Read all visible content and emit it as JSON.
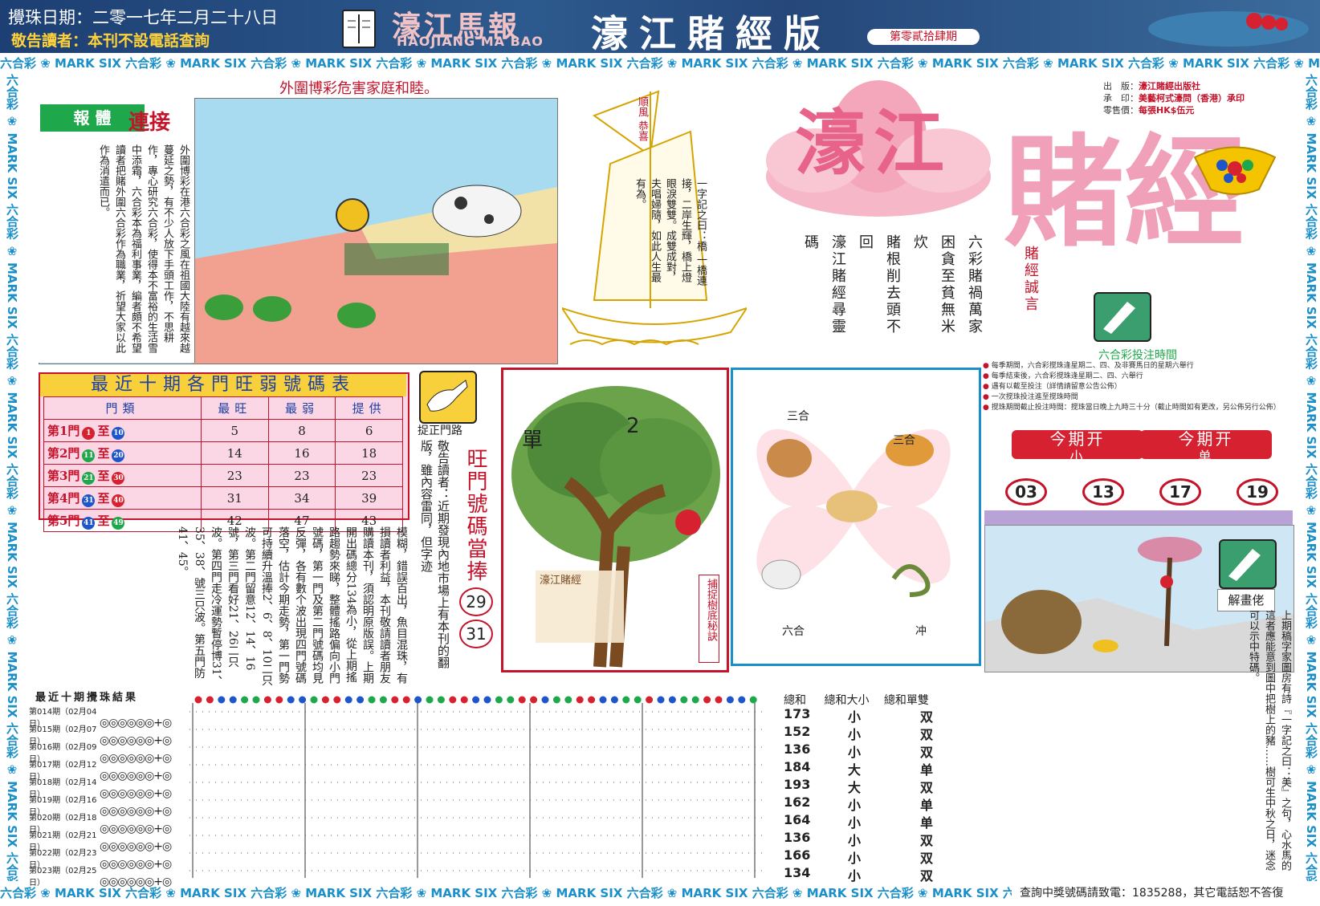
{
  "header": {
    "date": "攪珠日期：二零一七年二月二十八日",
    "warning": "敬告讀者：本刊不設電話查詢",
    "logo_cn": "濠江馬報",
    "logo_en": "HAOJIANG MA BAO",
    "title": "濠江賭經版",
    "issue": "第零貳拾肆期"
  },
  "strip_text": "六合彩 ❀ MARK SIX 六合彩 ❀ MARK SIX 六合彩 ❀ MARK SIX 六合彩 ❀ MARK SIX 六合彩 ❀ MARK SIX 六合彩 ❀ MARK SIX 六合彩 ❀ MARK SIX 六合彩 ❀ MARK SIX 六合彩 ❀ MARK SIX 六合彩 ❀ MARK SIX 六合彩 ❀ MARK SIX",
  "cartoon": {
    "caption": "外圍博彩危害家庭和睦。",
    "box_title": "報 體",
    "box_title_red": "連接",
    "box_text": "外圍博彩在港六合彩之風在祖國大陸有越來越蔓延之勢，有不少人放下手頭工作，不思耕作，專心研究六合彩，使得本不富裕的生活雪中添霜，六合彩本為福利事業，編者頗不希望讀者把賭外圍六合彩作為職業，祈望大家以此作為消遣而已。"
  },
  "boat": {
    "sail": "順風 恭喜",
    "text": "一字記之曰：橋 一橋連接，二岸生輝，橋上燈眼淚雙雙。成雙成對，夫唱婦隨，如此人生最有為。"
  },
  "brand": {
    "title_1": "濠江",
    "title_2": "賭經",
    "cols": [
      "六彩賭禍萬家",
      "困貪至貧無米炊",
      "賭根削去頭不回",
      "濠江賭經尋靈碼"
    ],
    "motto": "賭經誠言",
    "pub_lines": [
      {
        "k": "出　版：",
        "v": "濠江賭經出版社"
      },
      {
        "k": "承　印：",
        "v": "美藝柯式濠問（香港）承印"
      },
      {
        "k": "零售價：",
        "v": "每張HK$伍元"
      }
    ],
    "time_caption": "六合彩投注時間",
    "time_notes": [
      "每季期間，六合彩搅珠逢星期二、四、及非賽馬日的星期六舉行",
      "每季結束後，六合彩搅珠逢星期二、四、六舉行",
      "遇有以截至投注（詳情請留意公告公佈）",
      "一次搅珠投注進至搅珠時間",
      "搅珠期間截止投注時間：搅珠當日晚上九時三十分（截止時間如有更改，另公佈另行公佈）"
    ]
  },
  "table": {
    "title": "最近十期各門旺弱號碼表",
    "headers": [
      "門類",
      "最旺",
      "最弱",
      "提供"
    ],
    "rows": [
      {
        "door": "第1門",
        "from": "1",
        "to": "10",
        "max": "5",
        "min": "8",
        "give": "6",
        "c1": "b-r",
        "c2": "b-b"
      },
      {
        "door": "第2門",
        "from": "11",
        "to": "20",
        "max": "14",
        "min": "16",
        "give": "18",
        "c1": "b-g",
        "c2": "b-b"
      },
      {
        "door": "第3門",
        "from": "21",
        "to": "30",
        "max": "23",
        "min": "23",
        "give": "23",
        "c1": "b-g",
        "c2": "b-r"
      },
      {
        "door": "第4門",
        "from": "31",
        "to": "40",
        "max": "31",
        "min": "34",
        "give": "39",
        "c1": "b-b",
        "c2": "b-r"
      },
      {
        "door": "第5門",
        "from": "41",
        "to": "49",
        "max": "42",
        "min": "47",
        "give": "43",
        "c1": "b-b",
        "c2": "b-g"
      }
    ]
  },
  "tips": {
    "label": "捉正門路",
    "notice": "敬告讀者：近期發現內地市場上有本刊的翻版，雖內容雷同，但字迹",
    "wang_title": "旺門號碼當捧",
    "wang_nums": [
      "29",
      "31"
    ],
    "body": "模糊，錯誤百出，魚目混珠，有損讀者利益，本刊敬請讀者朋友購讀本刊，須認明原版誤。上期開出碼總分134為小，從上期搖路趨勢來睇，整體搖路偏向小門號碼，第一門及第二門號碼均見反彈，各有數个波出現四門號碼落空，估計今期走勢，第一門勢可持續升溫捧2、6、8、10二只波。第二門留意12、14、16號，第三門看好21、26二只波。第四門走冷運勢暫停博31、35、38、號三只波。第五門防41、45。"
  },
  "tree": {
    "dan": "單",
    "two": "2",
    "side": "捕捉樹底秘訣",
    "inscription": "濠江賭經"
  },
  "zodiac": {
    "labels": [
      "三合",
      "三合",
      "六合",
      "冲"
    ]
  },
  "draw": {
    "pill_label": "今期开",
    "left_sub": "小",
    "right_sub": "单",
    "numbers": [
      "03",
      "13",
      "17",
      "19"
    ]
  },
  "painting": {
    "label": "解畫佬",
    "comment": "上期稿字家圖房有詩『一字記之曰：美』之句，心水馬的這者應能意到圖中把樹上的豬……樹可生中秋之日，迷念可以示中特碼。"
  },
  "results": {
    "title": "最近十期攪珠結果",
    "periods": [
      "第014期（02月04日）",
      "第015期（02月07日）",
      "第016期（02月09日）",
      "第017期（02月12日）",
      "第018期（02月14日）",
      "第019期（02月16日）",
      "第020期（02月18日）",
      "第021期（02月21日）",
      "第022期（02月23日）",
      "第023期（02月25日）"
    ]
  },
  "sums": {
    "headers": [
      "總和",
      "總和大小",
      "總和單雙"
    ],
    "rows": [
      {
        "total": "173",
        "size": "小",
        "parity": "双"
      },
      {
        "total": "152",
        "size": "小",
        "parity": "双"
      },
      {
        "total": "136",
        "size": "小",
        "parity": "双"
      },
      {
        "total": "184",
        "size": "大",
        "parity": "单"
      },
      {
        "total": "193",
        "size": "大",
        "parity": "双"
      },
      {
        "total": "162",
        "size": "小",
        "parity": "单"
      },
      {
        "total": "164",
        "size": "小",
        "parity": "单"
      },
      {
        "total": "136",
        "size": "小",
        "parity": "双"
      },
      {
        "total": "166",
        "size": "小",
        "parity": "双"
      },
      {
        "total": "134",
        "size": "小",
        "parity": "双"
      }
    ]
  },
  "footer": {
    "note": "查詢中獎號碼請致電：1835288，其它電話恕不答復"
  },
  "colors": {
    "header_bg": "#1d3f73",
    "accent_red": "#c4132a",
    "strip_blue": "#1a8fc9",
    "table_pink": "#fbd7e6"
  }
}
